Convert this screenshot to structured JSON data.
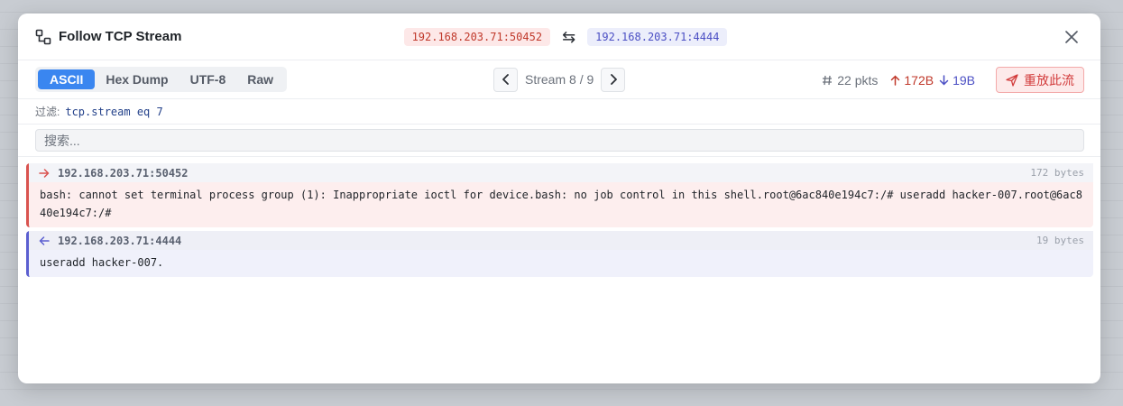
{
  "header": {
    "title": "Follow TCP Stream",
    "src_endpoint": "192.168.203.71:50452",
    "dst_endpoint": "192.168.203.71:4444",
    "swap_glyph": "⇆"
  },
  "toolbar": {
    "modes": [
      "ASCII",
      "Hex Dump",
      "UTF-8",
      "Raw"
    ],
    "active_mode": "ASCII",
    "stream_label": "Stream 8 / 9",
    "packets": "22 pkts",
    "bytes_up": "172B",
    "bytes_down": "19B",
    "replay_label": "重放此流"
  },
  "filter": {
    "label": "过滤:",
    "value": "tcp.stream eq 7"
  },
  "search": {
    "placeholder": "搜索..."
  },
  "messages": [
    {
      "direction": "out",
      "endpoint": "192.168.203.71:50452",
      "size": "172 bytes",
      "body": "bash: cannot set terminal process group (1): Inappropriate ioctl for device.bash: no job control in this shell.root@6ac840e194c7:/# useradd hacker-007.root@6ac840e194c7:/#"
    },
    {
      "direction": "in",
      "endpoint": "192.168.203.71:4444",
      "size": "19 bytes",
      "body": "useradd hacker-007."
    }
  ],
  "colors": {
    "accent": "#3a86f0",
    "outbound": "#d9534f",
    "inbound": "#5b5fd0"
  }
}
